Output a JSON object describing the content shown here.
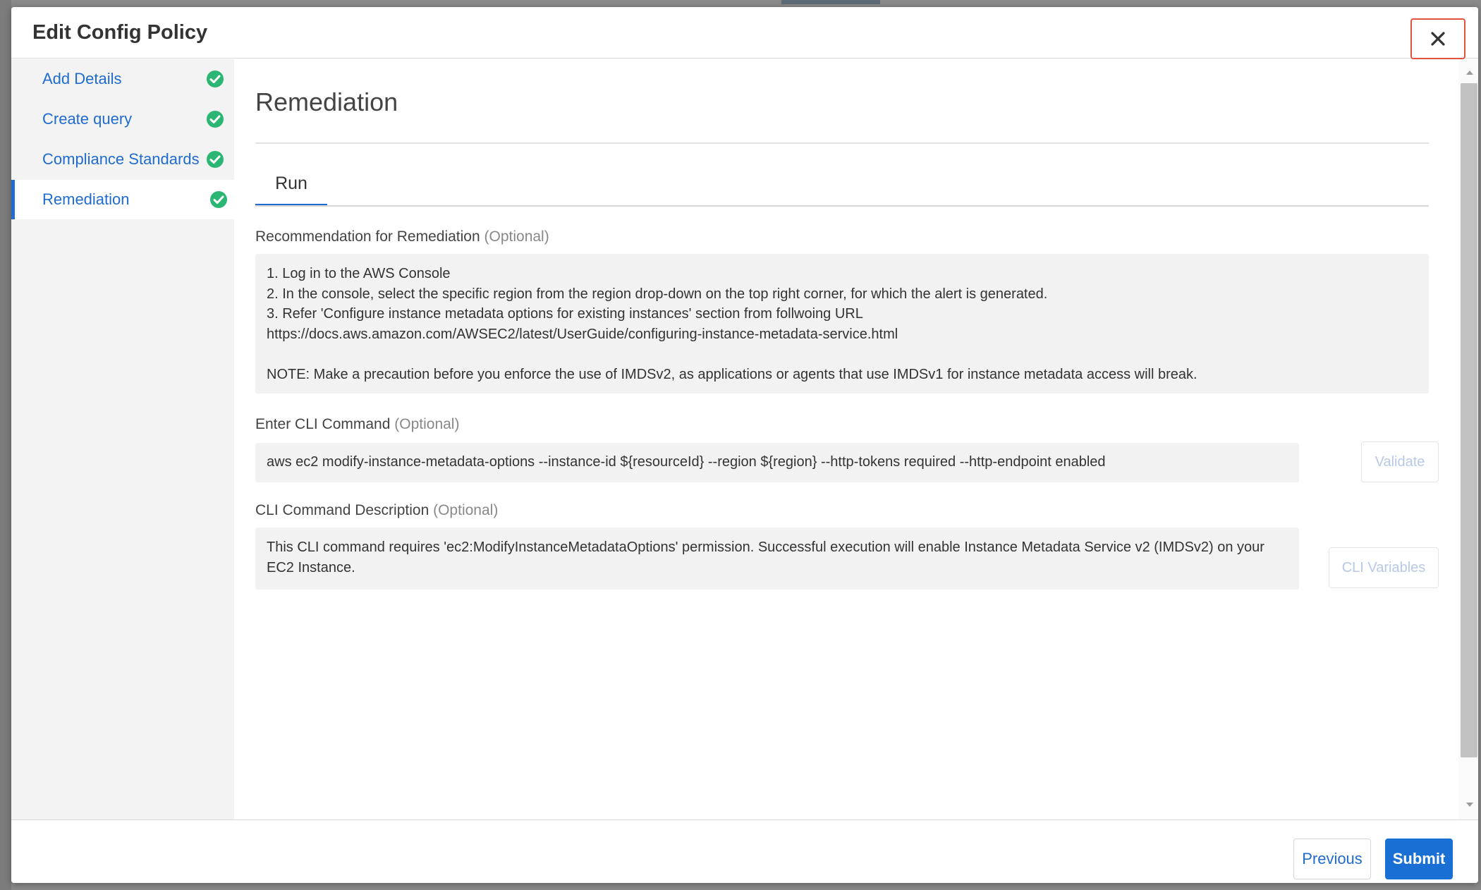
{
  "modal": {
    "title": "Edit Config Policy"
  },
  "sidebar": {
    "items": [
      {
        "label": "Add Details",
        "status": "complete",
        "active": false
      },
      {
        "label": "Create query",
        "status": "complete",
        "active": false
      },
      {
        "label": "Compliance Standards",
        "status": "complete",
        "active": false
      },
      {
        "label": "Remediation",
        "status": "complete",
        "active": true
      }
    ]
  },
  "main": {
    "section_title": "Remediation",
    "tabs": [
      {
        "label": "Run",
        "active": true
      }
    ],
    "recommendation": {
      "label": "Recommendation for Remediation",
      "optional": "(Optional)",
      "text": "1. Log in to the AWS Console\n2. In the console, select the specific region from the region drop-down on the top right corner, for which the alert is generated.\n3. Refer 'Configure instance metadata options for existing instances' section from follwoing URL\nhttps://docs.aws.amazon.com/AWSEC2/latest/UserGuide/configuring-instance-metadata-service.html\n\nNOTE: Make a precaution before you enforce the use of IMDSv2, as applications or agents that use IMDSv1 for instance metadata access will break."
    },
    "cli_command": {
      "label": "Enter CLI Command",
      "optional": "(Optional)",
      "value": "aws ec2 modify-instance-metadata-options --instance-id ${resourceId} --region ${region} --http-tokens required --http-endpoint enabled",
      "validate_label": "Validate"
    },
    "cli_description": {
      "label": "CLI Command Description",
      "optional": "(Optional)",
      "value": "This CLI command requires 'ec2:ModifyInstanceMetadataOptions' permission. Successful execution will enable Instance Metadata Service v2 (IMDSv2) on your EC2 Instance.",
      "variables_label": "CLI Variables"
    }
  },
  "footer": {
    "previous_label": "Previous",
    "submit_label": "Submit"
  },
  "colors": {
    "accent": "#1f6bcf",
    "check_green": "#2bb673",
    "close_highlight": "#e2533d"
  },
  "icons": {
    "close": "close-icon",
    "check": "check-circle-icon"
  }
}
